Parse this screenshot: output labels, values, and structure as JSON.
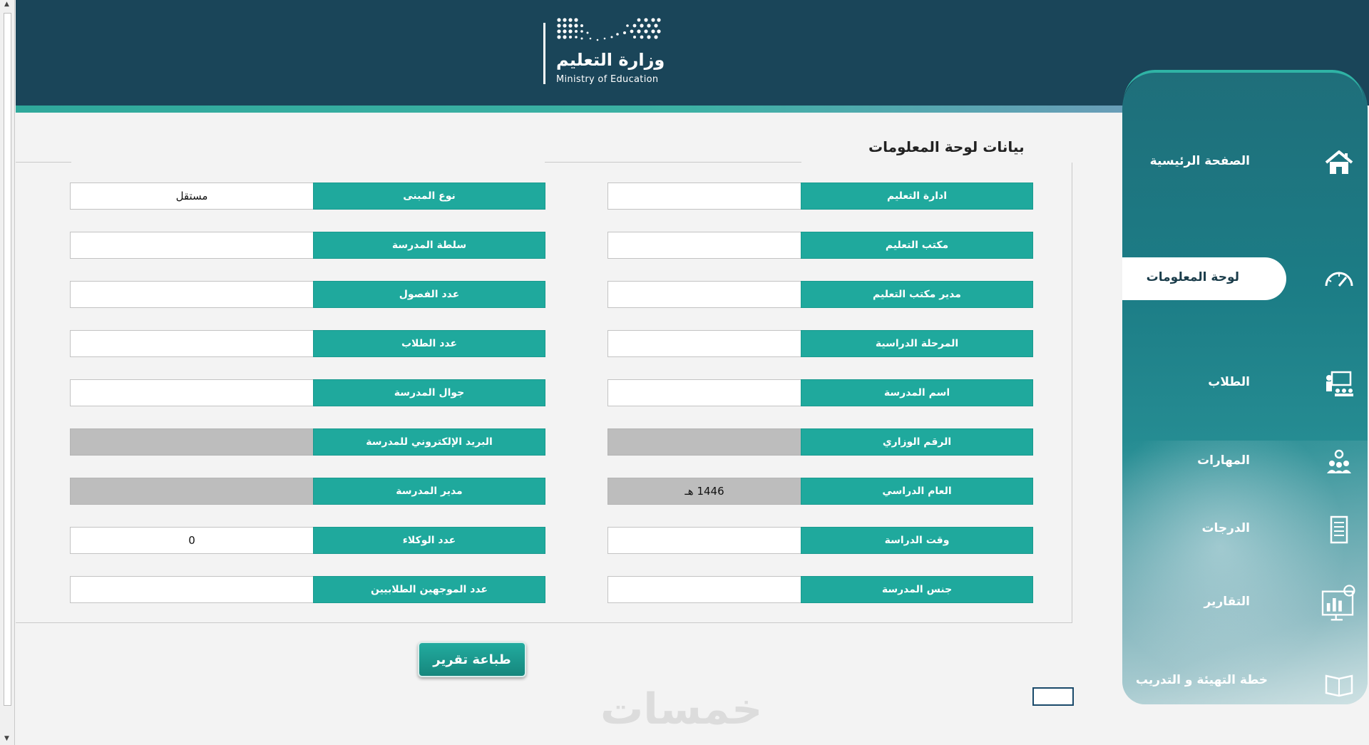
{
  "header": {
    "logo_ar": "وزارة التعليم",
    "logo_en": "Ministry of Education"
  },
  "section_title": "بيانات لوحة المعلومات",
  "fields_right": [
    {
      "label": "ادارة التعليم",
      "value": "",
      "grey": false
    },
    {
      "label": "مكتب التعليم",
      "value": "",
      "grey": false
    },
    {
      "label": "مدير مكتب التعليم",
      "value": "",
      "grey": false
    },
    {
      "label": "المرحلة الدراسية",
      "value": "",
      "grey": false
    },
    {
      "label": "اسم المدرسة",
      "value": "",
      "grey": false
    },
    {
      "label": "الرقم  الوزاري",
      "value": "",
      "grey": true
    },
    {
      "label": "العام الدراسي",
      "value": "1446 هـ",
      "grey": true
    },
    {
      "label": "وقت الدراسة",
      "value": "",
      "grey": false
    },
    {
      "label": "جنس المدرسة",
      "value": "",
      "grey": false
    }
  ],
  "fields_left": [
    {
      "label": "نوع المبنى",
      "value": "مستقل",
      "grey": false
    },
    {
      "label": "سلطة المدرسة",
      "value": "",
      "grey": false
    },
    {
      "label": "عدد الفصول",
      "value": "",
      "grey": false
    },
    {
      "label": "عدد الطلاب",
      "value": "",
      "grey": false
    },
    {
      "label": "جوال المدرسة",
      "value": "",
      "grey": false
    },
    {
      "label": "البريد الإلكتروني للمدرسة",
      "value": "",
      "grey": true
    },
    {
      "label": "مدير المدرسة",
      "value": "",
      "grey": true
    },
    {
      "label": "عدد الوكلاء",
      "value": "0",
      "grey": false
    },
    {
      "label": "عدد الموجهين الطلابيين",
      "value": "",
      "grey": false
    }
  ],
  "print_button": "طباعة تقرير",
  "watermark": "خمسات",
  "sidebar": {
    "items": [
      {
        "label": "الصفحة الرئيسية",
        "icon": "home-icon"
      },
      {
        "label": "لوحة المعلومات",
        "icon": "speedometer-icon"
      },
      {
        "label": "الطلاب",
        "icon": "students-icon"
      },
      {
        "label": "المهارات",
        "icon": "skills-icon"
      },
      {
        "label": "الدرجات",
        "icon": "grades-icon"
      },
      {
        "label": "التقارير",
        "icon": "reports-icon"
      },
      {
        "label": "خطة التهيئة و التدريب",
        "icon": "book-icon"
      }
    ]
  }
}
